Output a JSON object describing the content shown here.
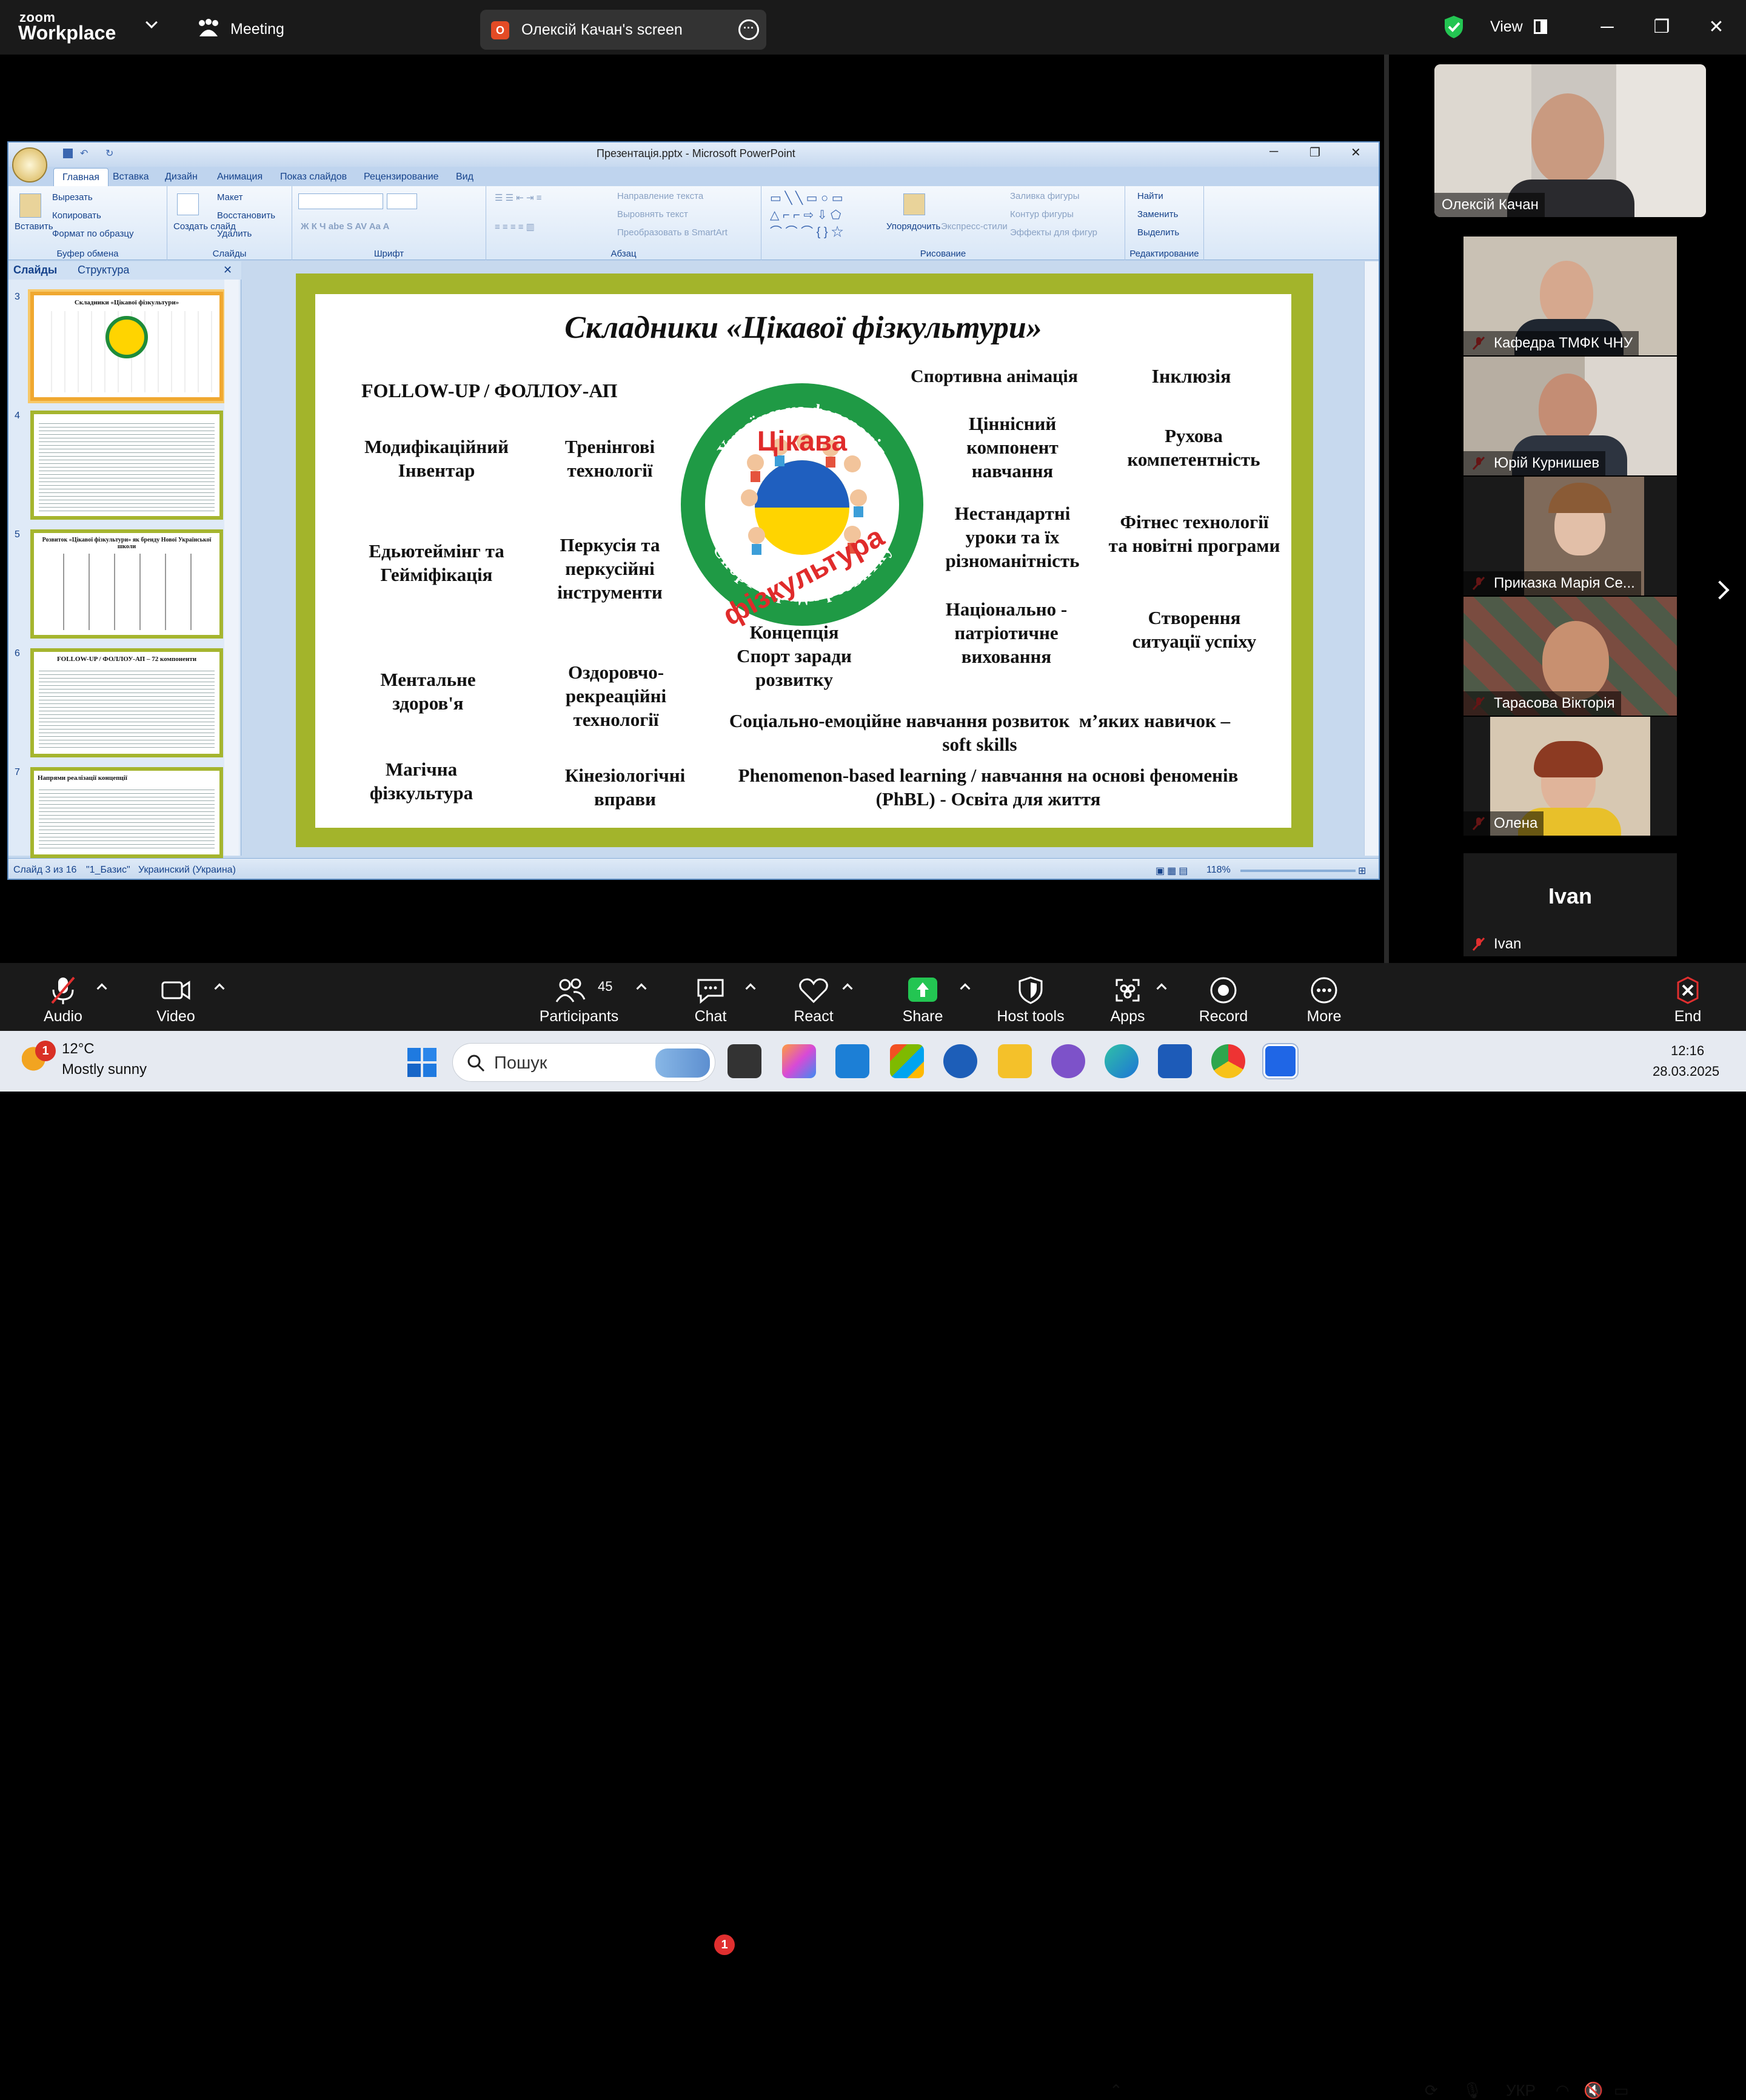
{
  "zoom": {
    "logo_line1": "zoom",
    "logo_line2": "Workplace",
    "meeting_label": "Meeting",
    "share_title": "Олексій Качан's screen",
    "share_icon_letter": "O",
    "view_label": "View",
    "accent_green": "#23c552",
    "end_red": "#e02f2f"
  },
  "ppt": {
    "window_title": "Презентація.pptx - Microsoft PowerPoint",
    "tabs": [
      "Главная",
      "Вставка",
      "Дизайн",
      "Анимация",
      "Показ слайдов",
      "Рецензирование",
      "Вид"
    ],
    "ribbon": {
      "paste": "Вставить",
      "cut": "Вырезать",
      "copy": "Копировать",
      "format_painter": "Формат по образцу",
      "clipboard_group": "Буфер обмена",
      "new_slide": "Создать слайд",
      "layout": "Макет",
      "reset": "Восстановить",
      "delete": "Удалить",
      "slides_group": "Слайды",
      "font_group": "Шрифт",
      "text_direction": "Направление текста",
      "align_text": "Выровнять текст",
      "smartart": "Преобразовать в SmartArt",
      "paragraph_group": "Абзац",
      "arrange": "Упорядочить",
      "quick_styles": "Экспресс-стили",
      "shape_fill": "Заливка фигуры",
      "shape_outline": "Контур фигуры",
      "shape_effects": "Эффекты для фигур",
      "drawing_group": "Рисование",
      "find": "Найти",
      "replace": "Заменить",
      "select": "Выделить",
      "editing_group": "Редактирование"
    },
    "pane_tabs": [
      "Слайды",
      "Структура"
    ],
    "thumbs": [
      {
        "num": "3",
        "title": "Складники «Цікавої фізкультури»"
      },
      {
        "num": "4",
        "title": ""
      },
      {
        "num": "5",
        "title": "Розвиток «Цікавої фізкультури» як бренду Нової Української школи"
      },
      {
        "num": "6",
        "title": "FOLLOW-UP / ФОЛЛОУ-АП – 72 компоненти"
      },
      {
        "num": "7",
        "title": "Напрями реалізації концепції"
      }
    ],
    "status": {
      "slide": "Слайд 3 из 16",
      "theme": "\"1_Базис\"",
      "language": "Украинский (Украина)",
      "zoom": "118%"
    }
  },
  "slide": {
    "title": "Складники «Цікавої фізкультури»",
    "items": {
      "follow": "FOLLOW-UP / ФОЛЛОУ-АП",
      "sport_anim": "Спортивна анімація",
      "inclusion": "Інклюзія",
      "modif": "Модифікаційний\nІнвентар",
      "training": "Тренінгові\nтехнології",
      "value": "Ціннісний\nкомпонент\nнавчання",
      "motor": "Рухова\nкомпетентність",
      "edu": "Едьютеймінг та\nГейміфікація",
      "perc": "Перкусія та\nперкусійні\nінструменти",
      "nonstd": "Нестандартні\nуроки та їх\nрізноманітність",
      "fitness": "Фітнес технології\nта новітні програми",
      "concept": "Концепція\nСпорт заради\nрозвитку",
      "natpat": "Національно -\nпатріотичне\nвиховання",
      "success": "Створення\nситуації успіху",
      "mental": "Ментальне\nздоров'я",
      "health": "Оздоровчо-\nрекреаційні\nтехнології",
      "sel": "Соціально-емоційне навчання розвиток  м’яких навичок –\nsoft skills",
      "magic": "Магічна\nфізкультура",
      "kinesio": "Кінезіологічні\nвправи",
      "pbl": "Phenomenon-based learning / навчання на основі феноменів\n(PhBL) - Освіта для життя"
    },
    "logo_top_text": "Українська федерація",
    "logo_word1": "Цікава",
    "logo_word2": "фізкультура",
    "logo_bottom_text": "Спорт заради розвитку"
  },
  "participants": [
    {
      "name": "Олексій Качан",
      "muted": false
    },
    {
      "name": "Кафедра ТМФК ЧНУ",
      "muted": true
    },
    {
      "name": "Юрій Курнишев",
      "muted": true
    },
    {
      "name": "Приказка Марія Се...",
      "muted": true
    },
    {
      "name": "Тарасова Вікторія",
      "muted": true
    },
    {
      "name": "Олена",
      "muted": true
    },
    {
      "name": "Ivan",
      "muted": true,
      "avatar_text": "Ivan"
    }
  ],
  "toolbar": {
    "audio": "Audio",
    "video": "Video",
    "participants": "Participants",
    "participants_count": "45",
    "chat": "Chat",
    "chat_badge": "1",
    "react": "React",
    "share": "Share",
    "host_tools": "Host tools",
    "apps": "Apps",
    "record": "Record",
    "more": "More",
    "end": "End"
  },
  "taskbar": {
    "temperature": "12°C",
    "weather": "Mostly sunny",
    "weather_badge": "1",
    "search_placeholder": "Пошук",
    "lang": "УКР",
    "time": "12:16",
    "date": "28.03.2025"
  }
}
